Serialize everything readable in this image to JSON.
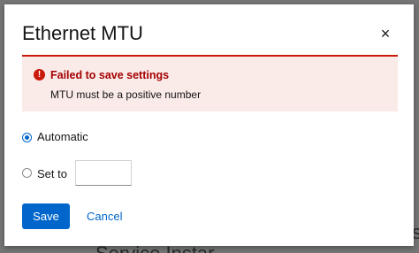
{
  "background": {
    "text": "Service Instar ",
    "right_text": "s"
  },
  "dialog": {
    "title": "Ethernet MTU",
    "close_glyph": "×"
  },
  "alert": {
    "icon": "!",
    "title": "Failed to save settings",
    "message": "MTU must be a positive number"
  },
  "options": {
    "automatic": {
      "label": "Automatic",
      "selected": true
    },
    "set_to": {
      "label": "Set to",
      "selected": false,
      "value": ""
    }
  },
  "actions": {
    "save_label": "Save",
    "cancel_label": "Cancel"
  },
  "colors": {
    "accent": "#0066cc",
    "danger": "#c9190b",
    "alert_bg": "#faeae8"
  }
}
